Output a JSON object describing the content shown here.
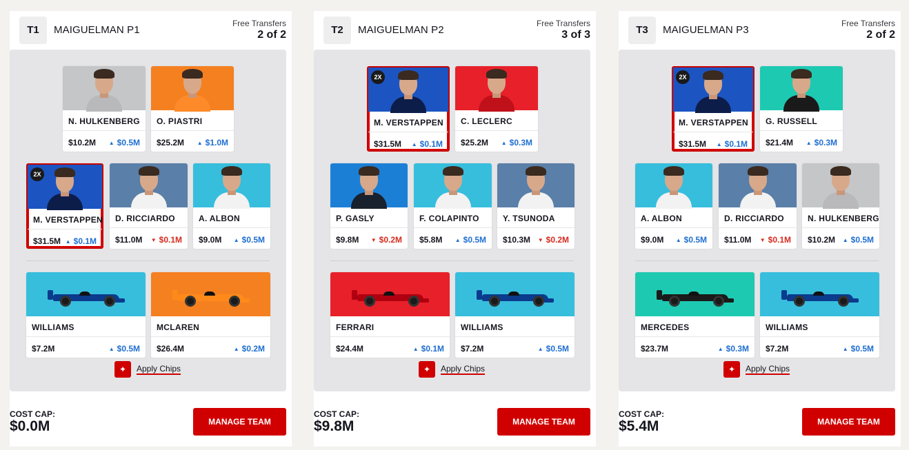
{
  "colors": {
    "accent": "#d10000",
    "up": "#1f6fd1",
    "down": "#d52b1e"
  },
  "teams": [
    {
      "tag": "T1",
      "name": "MAIGUELMAN P1",
      "free_transfers_label": "Free Transfers",
      "free_transfers_value": "2 of 2",
      "drivers": [
        {
          "name": "N. HULKENBERG",
          "price": "$10.2M",
          "change": "$0.5M",
          "dir": "up",
          "bg": "#c4c6c8",
          "suit": "#b9b9bc",
          "badge": ""
        },
        {
          "name": "O. PIASTRI",
          "price": "$25.2M",
          "change": "$1.0M",
          "dir": "up",
          "bg": "#f58020",
          "suit": "#ff8a2a",
          "badge": ""
        },
        {
          "name": "M. VERSTAPPEN",
          "price": "$31.5M",
          "change": "$0.1M",
          "dir": "up",
          "bg": "#1c55c2",
          "suit": "#0d1d4a",
          "badge": "2X"
        },
        {
          "name": "D. RICCIARDO",
          "price": "$11.0M",
          "change": "$0.1M",
          "dir": "down",
          "bg": "#5a7fa8",
          "suit": "#f2f2f2",
          "badge": ""
        },
        {
          "name": "A. ALBON",
          "price": "$9.0M",
          "change": "$0.5M",
          "dir": "up",
          "bg": "#37bedd",
          "suit": "#f2f2f2",
          "badge": ""
        }
      ],
      "constructors": [
        {
          "name": "WILLIAMS",
          "price": "$7.2M",
          "change": "$0.5M",
          "dir": "up",
          "bg": "#37bedd",
          "car": "#0b3b8c"
        },
        {
          "name": "MCLAREN",
          "price": "$26.4M",
          "change": "$0.2M",
          "dir": "up",
          "bg": "#f58020",
          "car": "#ff8a1a"
        }
      ],
      "chips_label": "Apply Chips",
      "cost_cap_label": "COST CAP:",
      "cost_cap_value": "$0.0M",
      "manage_label": "MANAGE TEAM"
    },
    {
      "tag": "T2",
      "name": "MAIGUELMAN P2",
      "free_transfers_label": "Free Transfers",
      "free_transfers_value": "3 of 3",
      "drivers": [
        {
          "name": "M. VERSTAPPEN",
          "price": "$31.5M",
          "change": "$0.1M",
          "dir": "up",
          "bg": "#1c55c2",
          "suit": "#0d1d4a",
          "badge": "2X"
        },
        {
          "name": "C. LECLERC",
          "price": "$25.2M",
          "change": "$0.3M",
          "dir": "up",
          "bg": "#e8202a",
          "suit": "#c0101a",
          "badge": ""
        },
        {
          "name": "P. GASLY",
          "price": "$9.8M",
          "change": "$0.2M",
          "dir": "down",
          "bg": "#1c7fd6",
          "suit": "#18212e",
          "badge": ""
        },
        {
          "name": "F. COLAPINTO",
          "price": "$5.8M",
          "change": "$0.5M",
          "dir": "up",
          "bg": "#37bedd",
          "suit": "#f2f2f2",
          "badge": ""
        },
        {
          "name": "Y. TSUNODA",
          "price": "$10.3M",
          "change": "$0.2M",
          "dir": "down",
          "bg": "#5a7fa8",
          "suit": "#f2f2f2",
          "badge": ""
        }
      ],
      "constructors": [
        {
          "name": "FERRARI",
          "price": "$24.4M",
          "change": "$0.1M",
          "dir": "up",
          "bg": "#e8202a",
          "car": "#b00010"
        },
        {
          "name": "WILLIAMS",
          "price": "$7.2M",
          "change": "$0.5M",
          "dir": "up",
          "bg": "#37bedd",
          "car": "#0b3b8c"
        }
      ],
      "chips_label": "Apply Chips",
      "cost_cap_label": "COST CAP:",
      "cost_cap_value": "$9.8M",
      "manage_label": "MANAGE TEAM"
    },
    {
      "tag": "T3",
      "name": "MAIGUELMAN P3",
      "free_transfers_label": "Free Transfers",
      "free_transfers_value": "2 of 2",
      "drivers": [
        {
          "name": "M. VERSTAPPEN",
          "price": "$31.5M",
          "change": "$0.1M",
          "dir": "up",
          "bg": "#1c55c2",
          "suit": "#0d1d4a",
          "badge": "2X"
        },
        {
          "name": "G. RUSSELL",
          "price": "$21.4M",
          "change": "$0.3M",
          "dir": "up",
          "bg": "#1ec9b2",
          "suit": "#1a1a1a",
          "badge": ""
        },
        {
          "name": "A. ALBON",
          "price": "$9.0M",
          "change": "$0.5M",
          "dir": "up",
          "bg": "#37bedd",
          "suit": "#f2f2f2",
          "badge": ""
        },
        {
          "name": "D. RICCIARDO",
          "price": "$11.0M",
          "change": "$0.1M",
          "dir": "down",
          "bg": "#5a7fa8",
          "suit": "#f2f2f2",
          "badge": ""
        },
        {
          "name": "N. HULKENBERG",
          "price": "$10.2M",
          "change": "$0.5M",
          "dir": "up",
          "bg": "#c4c6c8",
          "suit": "#b9b9bc",
          "badge": ""
        }
      ],
      "constructors": [
        {
          "name": "MERCEDES",
          "price": "$23.7M",
          "change": "$0.3M",
          "dir": "up",
          "bg": "#1ec9b2",
          "car": "#1a1a1a"
        },
        {
          "name": "WILLIAMS",
          "price": "$7.2M",
          "change": "$0.5M",
          "dir": "up",
          "bg": "#37bedd",
          "car": "#0b3b8c"
        }
      ],
      "chips_label": "Apply Chips",
      "cost_cap_label": "COST CAP:",
      "cost_cap_value": "$5.4M",
      "manage_label": "MANAGE TEAM"
    }
  ]
}
